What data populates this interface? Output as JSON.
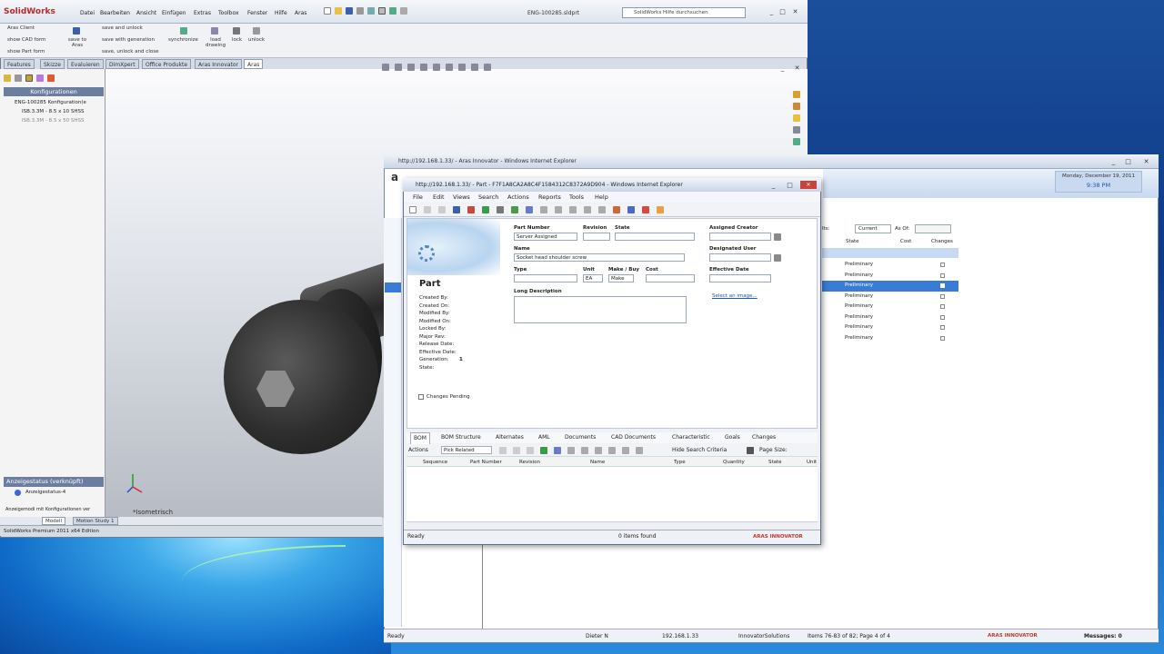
{
  "solidworks": {
    "app": "SolidWorks",
    "menu": [
      "Datei",
      "Bearbeiten",
      "Ansicht",
      "Einfügen",
      "Extras",
      "Toolbox",
      "Fenster",
      "Hilfe",
      "Aras"
    ],
    "document": "ENG-100285.sldprt",
    "search_placeholder": "SolidWorks Hilfe durchsuchen",
    "commands": {
      "aras_client": "Aras Client",
      "show_cad_form": "show CAD form",
      "show_part_form": "show Part form",
      "save_to_aras": "save to Aras",
      "save_and_unlock": "save and unlock",
      "save_with_generation": "save with generation",
      "save_unlock_close": "save, unlock and close",
      "synchronize": "synchronize",
      "load_drawing": "load drawing",
      "lock": "lock",
      "unlock": "unlock"
    },
    "tabs": [
      "Features",
      "Skizze",
      "Evaluieren",
      "DimXpert",
      "Office Produkte",
      "Aras Innovator",
      "Aras"
    ],
    "active_tab": "Aras",
    "feature_manager": {
      "header": "Konfigurationen",
      "root": "ENG-100285 Konfiguration(e",
      "items": [
        "ISB.3.3M - 8.5 x 10 SHSS",
        "ISB.3.3M - 8.5 x 50 SHSS"
      ]
    },
    "display_state": {
      "header": "Anzeigestatus (verknüpft)",
      "item": "Anzeigestatus-4",
      "checkbox_label": "Anzeigemodi mit Konfigurationen ver"
    },
    "view_label": "*Isometrisch",
    "bottom_tabs": [
      "Modell",
      "Motion Study 1"
    ],
    "status": "SolidWorks Premium 2011 x64 Edition"
  },
  "ie_main": {
    "title": "http://192.168.1.33/ - Aras Innovator - Windows Internet Explorer",
    "date": "Monday, December 19, 2011",
    "time": "9:38 PM",
    "filter": {
      "prefix": "Its:",
      "current": "Current",
      "as_of": "As Of:"
    },
    "columns": [
      "State",
      "Cost",
      "Changes"
    ],
    "rows": [
      "Preliminary",
      "Preliminary",
      "Preliminary",
      "Preliminary",
      "Preliminary",
      "Preliminary",
      "Preliminary",
      "Preliminary"
    ],
    "selected_row": 2,
    "status": {
      "ready": "Ready",
      "user": "Dieter N",
      "ip": "192.168.1.33",
      "company": "InnovatorSolutions",
      "items": "Items 76-83 of 82; Page 4 of 4",
      "logo": "ARAS INNOVATOR",
      "messages": "Messages: 0"
    }
  },
  "ie_dialog": {
    "title": "http://192.168.1.33/ - Part - F7F1A8CA2A8C4F1584312C8372A9D904 - Windows Internet Explorer",
    "menu": [
      "File",
      "Edit",
      "Views",
      "Search",
      "Actions",
      "Reports",
      "Tools",
      "Help"
    ],
    "item_type": "Part",
    "fields": {
      "part_number_label": "Part Number",
      "part_number": "Server Assigned",
      "revision_label": "Revision",
      "state_label": "State",
      "assigned_creator_label": "Assigned Creator",
      "name_label": "Name",
      "name": "Socket head shoulder screw",
      "designated_user_label": "Designated User",
      "type_label": "Type",
      "unit_label": "Unit",
      "unit": "EA",
      "make_buy_label": "Make / Buy",
      "make_buy": "Make",
      "cost_label": "Cost",
      "effective_date_label": "Effective Date",
      "long_description_label": "Long Description",
      "select_image": "Select an image..."
    },
    "properties": [
      "Created By:",
      "Created On:",
      "Modified By:",
      "Modified On:",
      "Locked By:",
      "Major Rev:",
      "Release Date:",
      "Effective Date:",
      "Generation:",
      "State:"
    ],
    "generation_value": "1",
    "changes_pending": "Changes Pending",
    "relationship_tabs": [
      "BOM",
      "BOM Structure",
      "Alternates",
      "AML",
      "Documents",
      "CAD Documents",
      "Characteristic",
      "Goals",
      "Changes"
    ],
    "actions_label": "Actions",
    "pick_related": "Pick Related",
    "hide_search": "Hide Search Criteria",
    "page_size": "Page Size:",
    "grid_columns": [
      "Sequence",
      "Part Number",
      "Revision",
      "Name",
      "Type",
      "Quantity",
      "State",
      "Unit"
    ],
    "status_ready": "Ready",
    "items_found": "0 items found",
    "logo": "ARAS INNOVATOR"
  }
}
